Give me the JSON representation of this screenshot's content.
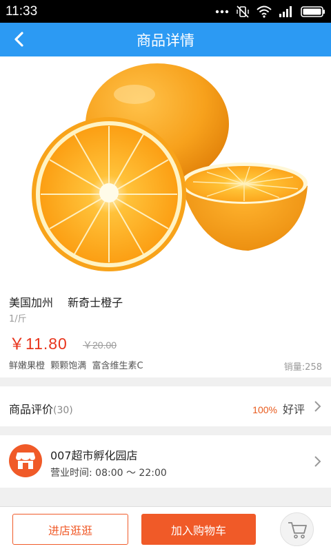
{
  "status_bar": {
    "time": "11:33"
  },
  "header": {
    "title": "商品详情",
    "back_icon": "chevron-left-icon"
  },
  "product": {
    "name": "美国加州　 新奇士橙子",
    "unit": "1/斤",
    "price": "￥11.80",
    "old_price": "￥20.00",
    "tags": "鲜嫩果橙  颗颗饱满  富含维生素C",
    "sales": "销量:258"
  },
  "reviews": {
    "label": "商品评价",
    "count": "(30)",
    "percent": "100%",
    "good_label": "好评"
  },
  "store": {
    "name": "007超市孵化园店",
    "hours": "营业时间: 08:00 ～ 22:00",
    "logo_icon": "store-icon"
  },
  "bottom_bar": {
    "visit_label": "进店逛逛",
    "add_cart_label": "加入购物车",
    "cart_icon": "shopping-cart-icon"
  },
  "colors": {
    "primary_blue": "#2c9af3",
    "accent_orange": "#f05a28",
    "price_red": "#e8341c"
  }
}
